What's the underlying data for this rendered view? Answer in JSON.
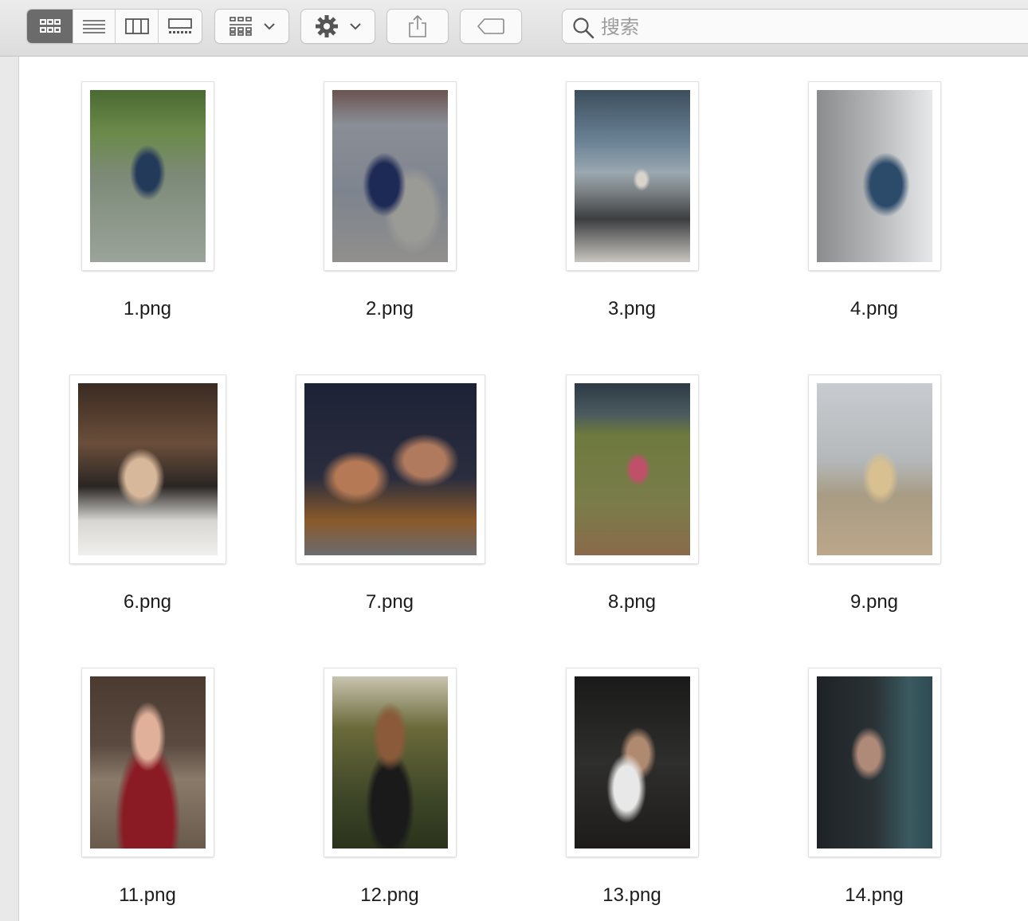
{
  "toolbar": {
    "view_modes": [
      {
        "name": "icon-view-icon",
        "active": true
      },
      {
        "name": "list-view-icon",
        "active": false
      },
      {
        "name": "column-view-icon",
        "active": false
      },
      {
        "name": "gallery-view-icon",
        "active": false
      }
    ],
    "group_icon": "group-by-icon",
    "action_icon": "gear-icon",
    "share_icon": "share-icon",
    "tag_icon": "tag-icon"
  },
  "search": {
    "placeholder": "搜索"
  },
  "files": [
    {
      "name": "1.png"
    },
    {
      "name": "2.png"
    },
    {
      "name": "3.png"
    },
    {
      "name": "4.png"
    },
    {
      "name": "6.png"
    },
    {
      "name": "7.png"
    },
    {
      "name": "8.png"
    },
    {
      "name": "9.png"
    },
    {
      "name": "11.png"
    },
    {
      "name": "12.png"
    },
    {
      "name": "13.png"
    },
    {
      "name": "14.png"
    }
  ],
  "colors": {
    "toolbar_bg": "#e2e2e2",
    "active_segment": "#6b6b6b",
    "icon": "#555555"
  }
}
